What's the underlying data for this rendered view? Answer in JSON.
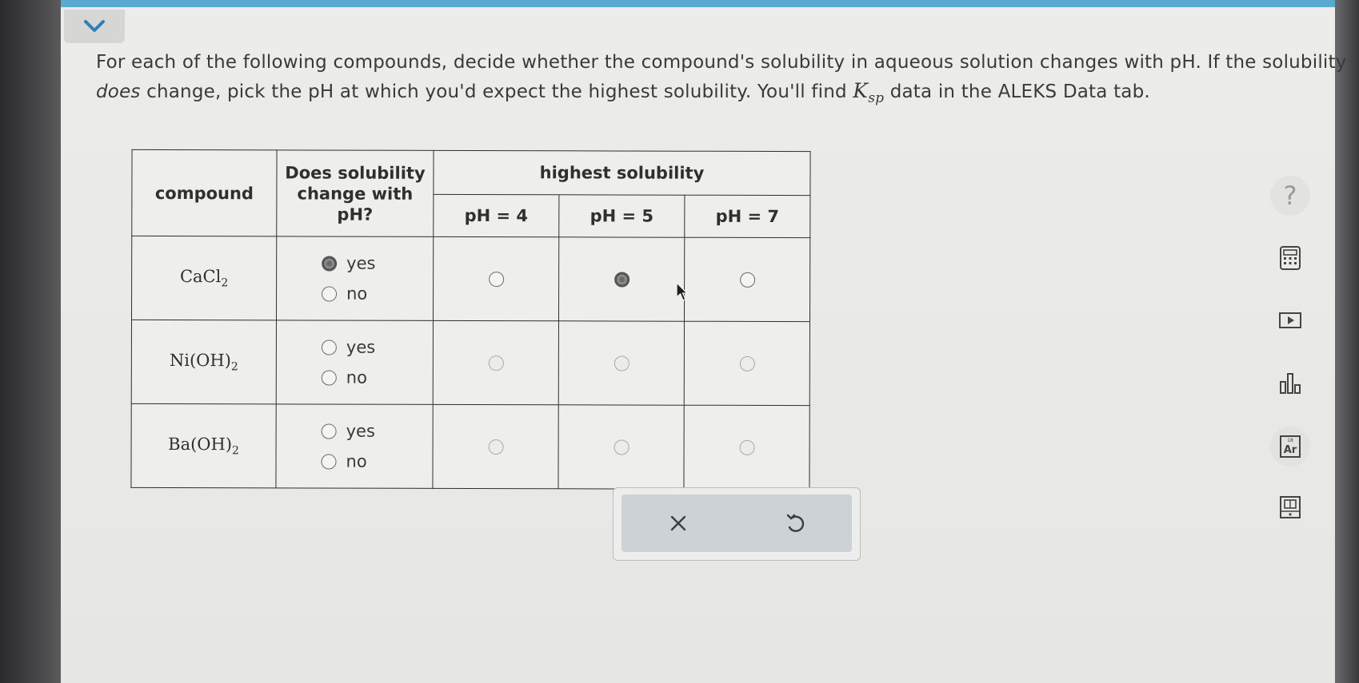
{
  "header": {
    "collapse_icon": "chevron-down-icon",
    "accent_color": "#5aa9cf"
  },
  "question": {
    "text_part1": "For each of the following compounds, decide whether the compound's solubility in aqueous solution changes with pH. If the solubility ",
    "emphasis": "does",
    "text_part2": " change, pick the pH at which you'd expect the highest solubility. You'll find ",
    "ksp_symbol": "K",
    "ksp_sub": "sp",
    "text_part3": " data in the ALEKS Data tab."
  },
  "table": {
    "col_compound": "compound",
    "col_change": "Does solubility change with pH?",
    "col_highest": "highest solubility",
    "ph_headers": [
      "pH = 4",
      "pH = 5",
      "pH = 7"
    ],
    "yes_label": "yes",
    "no_label": "no",
    "rows": [
      {
        "base": "CaCl",
        "sub": "2",
        "paren": false,
        "selected_change": "yes",
        "selected_ph": "pH = 5",
        "ph_enabled": true
      },
      {
        "base": "Ni",
        "group": "(OH)",
        "sub": "2",
        "paren": true,
        "selected_change": null,
        "selected_ph": null,
        "ph_enabled": false
      },
      {
        "base": "Ba",
        "group": "(OH)",
        "sub": "2",
        "paren": true,
        "selected_change": null,
        "selected_ph": null,
        "ph_enabled": false
      }
    ]
  },
  "actions": {
    "clear_icon": "close-icon",
    "undo_icon": "undo-icon"
  },
  "sidebar": {
    "help_label": "?",
    "icons": [
      "help-icon",
      "calculator-icon",
      "video-icon",
      "chart-icon",
      "periodic-table-icon",
      "data-tab-icon"
    ],
    "periodic_label": "Ar",
    "periodic_number": "18"
  }
}
